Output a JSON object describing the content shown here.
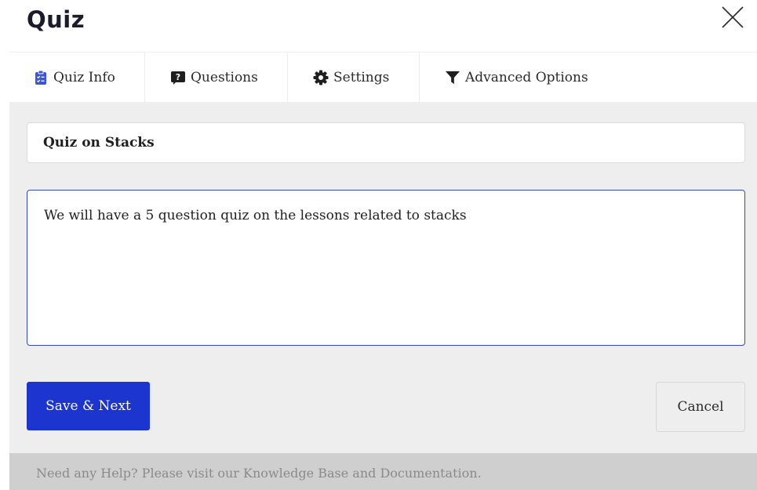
{
  "header": {
    "title": "Quiz"
  },
  "tabs": [
    {
      "label": "Quiz Info",
      "icon": "clipboard-list-icon",
      "active": true
    },
    {
      "label": "Questions",
      "icon": "question-square-icon",
      "active": false
    },
    {
      "label": "Settings",
      "icon": "gear-icon",
      "active": false
    },
    {
      "label": "Advanced Options",
      "icon": "filter-icon",
      "active": false
    }
  ],
  "form": {
    "name_value": "Quiz on Stacks",
    "description_value": "We will have a 5 question quiz on the lessons related to stacks"
  },
  "actions": {
    "save_label": "Save & Next",
    "cancel_label": "Cancel"
  },
  "footer": {
    "help_text": "Need any Help? Please visit our Knowledge Base and Documentation."
  },
  "colors": {
    "primary": "#1c35cf",
    "panel_bg": "#eeeeee",
    "footer_bg": "#cfcfcf",
    "active_icon": "#3a55d6"
  }
}
